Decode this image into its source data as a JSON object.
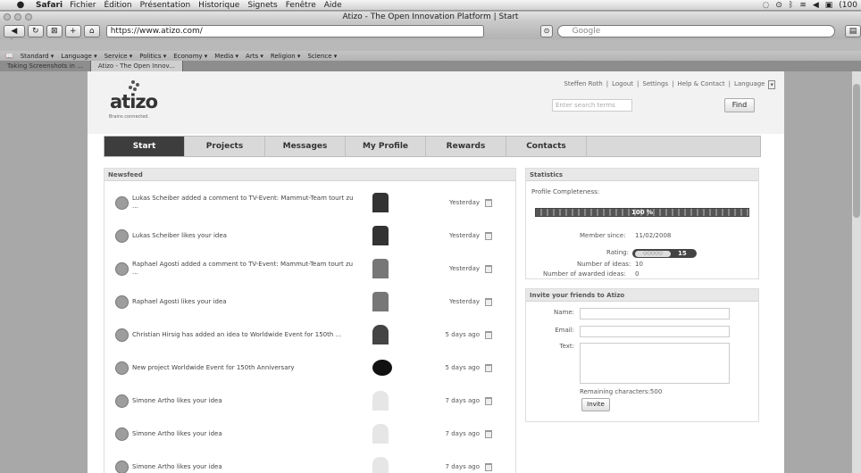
{
  "menubar": {
    "app": "Safari",
    "items": [
      "Fichier",
      "Édition",
      "Présentation",
      "Historique",
      "Signets",
      "Fenêtre",
      "Aide"
    ],
    "status": "(100"
  },
  "window": {
    "title": "Atizo - The Open Innovation Platform | Start"
  },
  "toolbar": {
    "url": "https://www.atizo.com/",
    "search_placeholder": "Google"
  },
  "bookmarks": [
    "Standard ▾",
    "Language ▾",
    "Service ▾",
    "Politics ▾",
    "Economy ▾",
    "Media ▾",
    "Arts ▾",
    "Religion ▾",
    "Science ▾"
  ],
  "tabs": [
    {
      "label": "Taking Screenshots in ..."
    },
    {
      "label": "Atizo - The Open Innov..."
    }
  ],
  "site": {
    "logo": "atizo",
    "tagline": "Brains connected.",
    "toplinks": [
      "Steffen Roth",
      "Logout",
      "Settings",
      "Help & Contact",
      "Language"
    ],
    "search_placeholder": "Enter search terms",
    "find_label": "Find",
    "nav": [
      "Start",
      "Projects",
      "Messages",
      "My Profile",
      "Rewards",
      "Contacts"
    ]
  },
  "newsfeed": {
    "title": "Newsfeed",
    "items": [
      {
        "text": "Lukas Scheiber added a comment to TV-Event: Mammut-Team tourt zu ...",
        "time": "Yesterday"
      },
      {
        "text": "Lukas Scheiber likes your idea",
        "time": "Yesterday"
      },
      {
        "text": "Raphael Agosti added a comment to TV-Event: Mammut-Team tourt zu ...",
        "time": "Yesterday"
      },
      {
        "text": "Raphael Agosti likes your idea",
        "time": "Yesterday"
      },
      {
        "text": "Christian Hirsig has added an idea to Worldwide Event for 150th ...",
        "time": "5 days ago"
      },
      {
        "text": "New project Worldwide Event for 150th Anniversary",
        "time": "5 days ago"
      },
      {
        "text": "Simone Artho likes your idea",
        "time": "7 days ago"
      },
      {
        "text": "Simone Artho likes your idea",
        "time": "7 days ago"
      },
      {
        "text": "Simone Artho likes your idea",
        "time": "7 days ago"
      }
    ]
  },
  "statistics": {
    "title": "Statistics",
    "completeness_label": "Profile Completeness:",
    "completeness_value": "100 %",
    "member_since_label": "Member since:",
    "member_since": "11/02/2008",
    "rating_label": "Rating:",
    "rating_value": "15",
    "ideas_label": "Number of ideas:",
    "ideas": "10",
    "awarded_label": "Number of awarded ideas:",
    "awarded": "0"
  },
  "invite": {
    "title": "Invite your friends to Atizo",
    "name_label": "Name:",
    "email_label": "Email:",
    "text_label": "Text:",
    "remaining": "Remaining characters:500",
    "button": "Invite"
  }
}
